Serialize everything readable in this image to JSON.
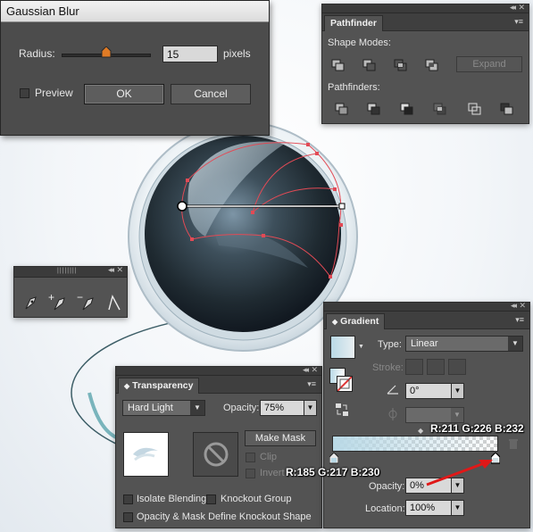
{
  "gaussian_blur": {
    "title": "Gaussian Blur",
    "radius_label": "Radius:",
    "radius_value": "15",
    "radius_unit": "pixels",
    "slider_fraction": 0.5,
    "preview_label": "Preview",
    "preview_checked": false,
    "ok_label": "OK",
    "cancel_label": "Cancel"
  },
  "pathfinder": {
    "tab": "Pathfinder",
    "shape_modes_label": "Shape Modes:",
    "expand_label": "Expand",
    "pathfinders_label": "Pathfinders:",
    "shape_mode_icons": [
      "unite-icon",
      "minus-front-icon",
      "intersect-icon",
      "exclude-icon"
    ],
    "pathfinder_icons": [
      "divide-icon",
      "trim-icon",
      "merge-icon",
      "crop-icon",
      "outline-icon",
      "minus-back-icon"
    ]
  },
  "pen_tools": {
    "icons": [
      "pen-tool-icon",
      "add-anchor-point-icon",
      "delete-anchor-point-icon",
      "convert-anchor-point-icon"
    ]
  },
  "transparency": {
    "tab": "Transparency",
    "blend_mode": "Hard Light",
    "opacity_label": "Opacity:",
    "opacity_value": "75%",
    "make_mask_label": "Make Mask",
    "clip_label": "Clip",
    "invert_mask_label": "Invert M",
    "isolate_blending_label": "Isolate Blending",
    "knockout_group_label": "Knockout Group",
    "opacity_mask_label": "Opacity & Mask Define Knockout Shape"
  },
  "gradient": {
    "tab": "Gradient",
    "type_label": "Type:",
    "type_value": "Linear",
    "stroke_label": "Stroke:",
    "angle_value": "0°",
    "opacity_label": "Opacity:",
    "opacity_value": "0%",
    "location_label": "Location:",
    "location_value": "100%",
    "colors": {
      "stop_left": "#b9d9e6",
      "stop_right": "#d3e2e8"
    }
  },
  "annotations": {
    "right_stop_rgb": "R:211 G:226 B:232",
    "left_stop_rgb": "R:185 G:217 B:230"
  }
}
